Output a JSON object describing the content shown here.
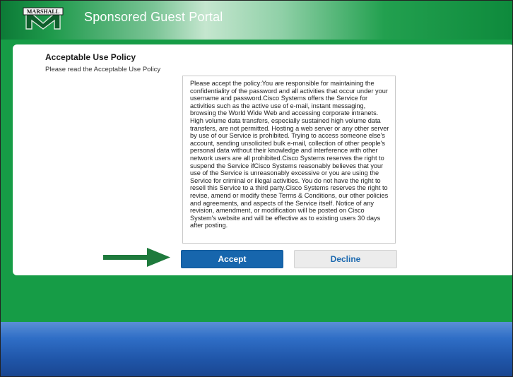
{
  "header": {
    "logo_text": "MARSHALL",
    "title": "Sponsored Guest Portal"
  },
  "card": {
    "title": "Acceptable Use Policy",
    "subtitle": "Please read the Acceptable Use Policy",
    "policy_text": "Please accept the policy:You are responsible for maintaining the confidentiality of the password and all activities that occur under your username and password.Cisco Systems offers the Service for activities such as the active use of e-mail, instant messaging, browsing the World Wide Web and accessing corporate intranets. High volume data transfers, especially sustained high volume data transfers, are not permitted. Hosting a web server or any other server by use of our Service is prohibited. Trying to access someone else's account, sending unsolicited bulk e-mail, collection of other people's personal data without their knowledge and interference with other network users are all prohibited.Cisco Systems reserves the right to suspend the Service ifCisco Systems reasonably believes that your use of the Service is unreasonably excessive or you are using the Service for criminal or illegal activities. You do not have the right to resell this Service to a third party.Cisco Systems reserves the right to revise, amend or modify these Terms & Conditions, our other policies and agreements, and aspects of the Service itself. Notice of any revision, amendment, or modification will be posted on Cisco System's website and will be effective as to existing users 30 days after posting.",
    "accept_label": "Accept",
    "decline_label": "Decline"
  },
  "colors": {
    "brand_green": "#169c46",
    "accept_blue": "#1766ad",
    "annotation_arrow": "#1e7a3c"
  }
}
